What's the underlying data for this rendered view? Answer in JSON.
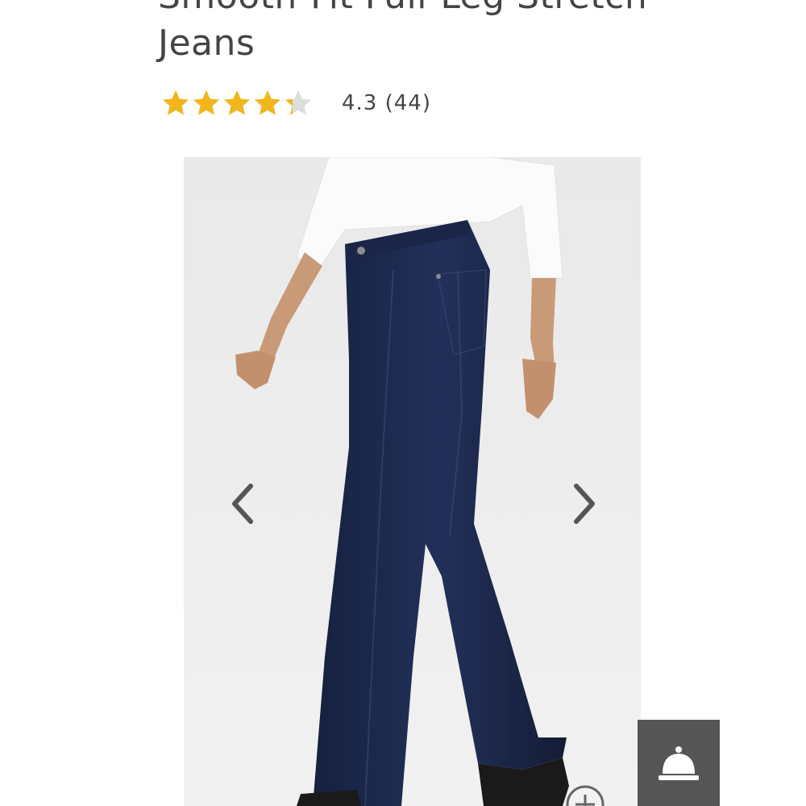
{
  "product": {
    "title_line1": "Smooth-Fit Full-Leg Stretch",
    "title_line2": "Jeans",
    "rating": {
      "value": 4.3,
      "text": "4.3 (44)",
      "max": 5
    },
    "gallery": {
      "prev_icon": "chevron-left-icon",
      "next_icon": "chevron-right-icon",
      "zoom_icon": "zoom-in-icon"
    }
  },
  "concierge": {
    "icon": "service-bell-icon"
  },
  "colors": {
    "star_filled": "#F2B61C",
    "star_empty": "#DDDDDD",
    "concierge_bg": "#555555",
    "denim": "#1E2A4F"
  }
}
